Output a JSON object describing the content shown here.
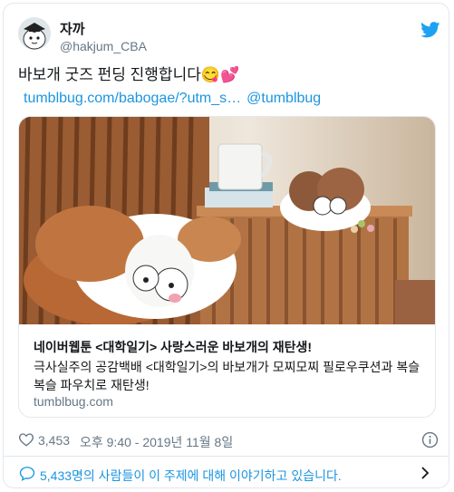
{
  "author": {
    "display_name": "자까",
    "handle": "@hakjum_CBA"
  },
  "tweet": {
    "text": "바보개 굿즈 펀딩 진행합니다",
    "emojis": "😋💕",
    "link_url": "tumblbug.com/babogae/?utm_s…",
    "link_mention": "@tumblbug"
  },
  "card": {
    "title": "네이버웹툰 <대학일기> 사랑스러운 바보개의 재탄생!",
    "description": "극사실주의 공감백배 <대학일기>의 바보개가 모찌모찌 필로우쿠션과 복슬복슬 파우치로 재탄생!",
    "domain": "tumblbug.com"
  },
  "meta": {
    "like_count": "3,453",
    "timestamp": "오후 9:40 - 2019년 11월 8일"
  },
  "conversation": {
    "text": "5,433명의 사람들이 이 주제에 대해 이야기하고 있습니다."
  },
  "colors": {
    "twitter_blue": "#1da1f2",
    "link_blue": "#1b95e0",
    "muted_gray": "#657786",
    "border_gray": "#e1e8ed"
  },
  "icons": [
    "twitter-bird-icon",
    "heart-icon",
    "info-icon",
    "chat-bubble-icon",
    "chevron-right-icon"
  ]
}
